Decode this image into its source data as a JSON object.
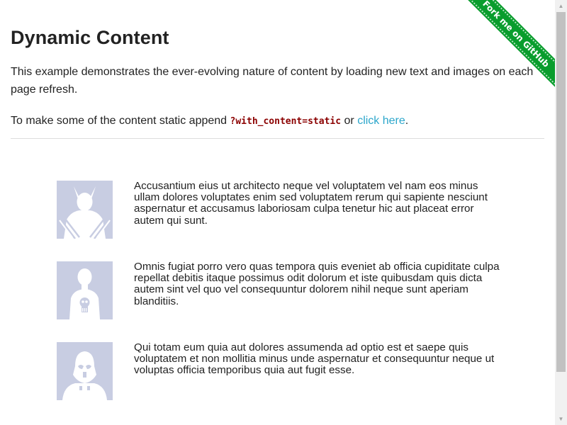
{
  "page": {
    "title": "Dynamic Content",
    "intro": "This example demonstrates the ever-evolving nature of content by loading new text and images on each page refresh.",
    "static_prefix": "To make some of the content static append ",
    "static_code": "?with_content=static",
    "static_or": " or ",
    "static_link": "click here",
    "static_suffix": "."
  },
  "ribbon": {
    "label": "Fork me on GitHub",
    "color": "#099d2d"
  },
  "rows": [
    {
      "avatar_icon": "wolverine-avatar-icon",
      "text": "Accusantium eius ut architecto neque vel voluptatem vel nam eos minus ullam dolores voluptates enim sed voluptatem rerum qui sapiente nesciunt aspernatur et accusamus laboriosam culpa tenetur hic aut placeat error autem qui sunt."
    },
    {
      "avatar_icon": "punisher-avatar-icon",
      "text": "Omnis fugiat porro vero quas tempora quis eveniet ab officia cupiditate culpa repellat debitis itaque possimus odit dolorum et iste quibusdam quis dicta autem sint vel quo vel consequuntur dolorem nihil neque sunt aperiam blanditiis."
    },
    {
      "avatar_icon": "stormtrooper-avatar-icon",
      "text": "Qui totam eum quia aut dolores assumenda ad optio est et saepe quis voluptatem et non mollitia minus unde aspernatur et consequuntur neque ut voluptas officia temporibus quia aut fugit esse."
    }
  ],
  "colors": {
    "link": "#2ba6cb",
    "code": "#8b0000",
    "avatar_bg": "#c8cde2"
  }
}
